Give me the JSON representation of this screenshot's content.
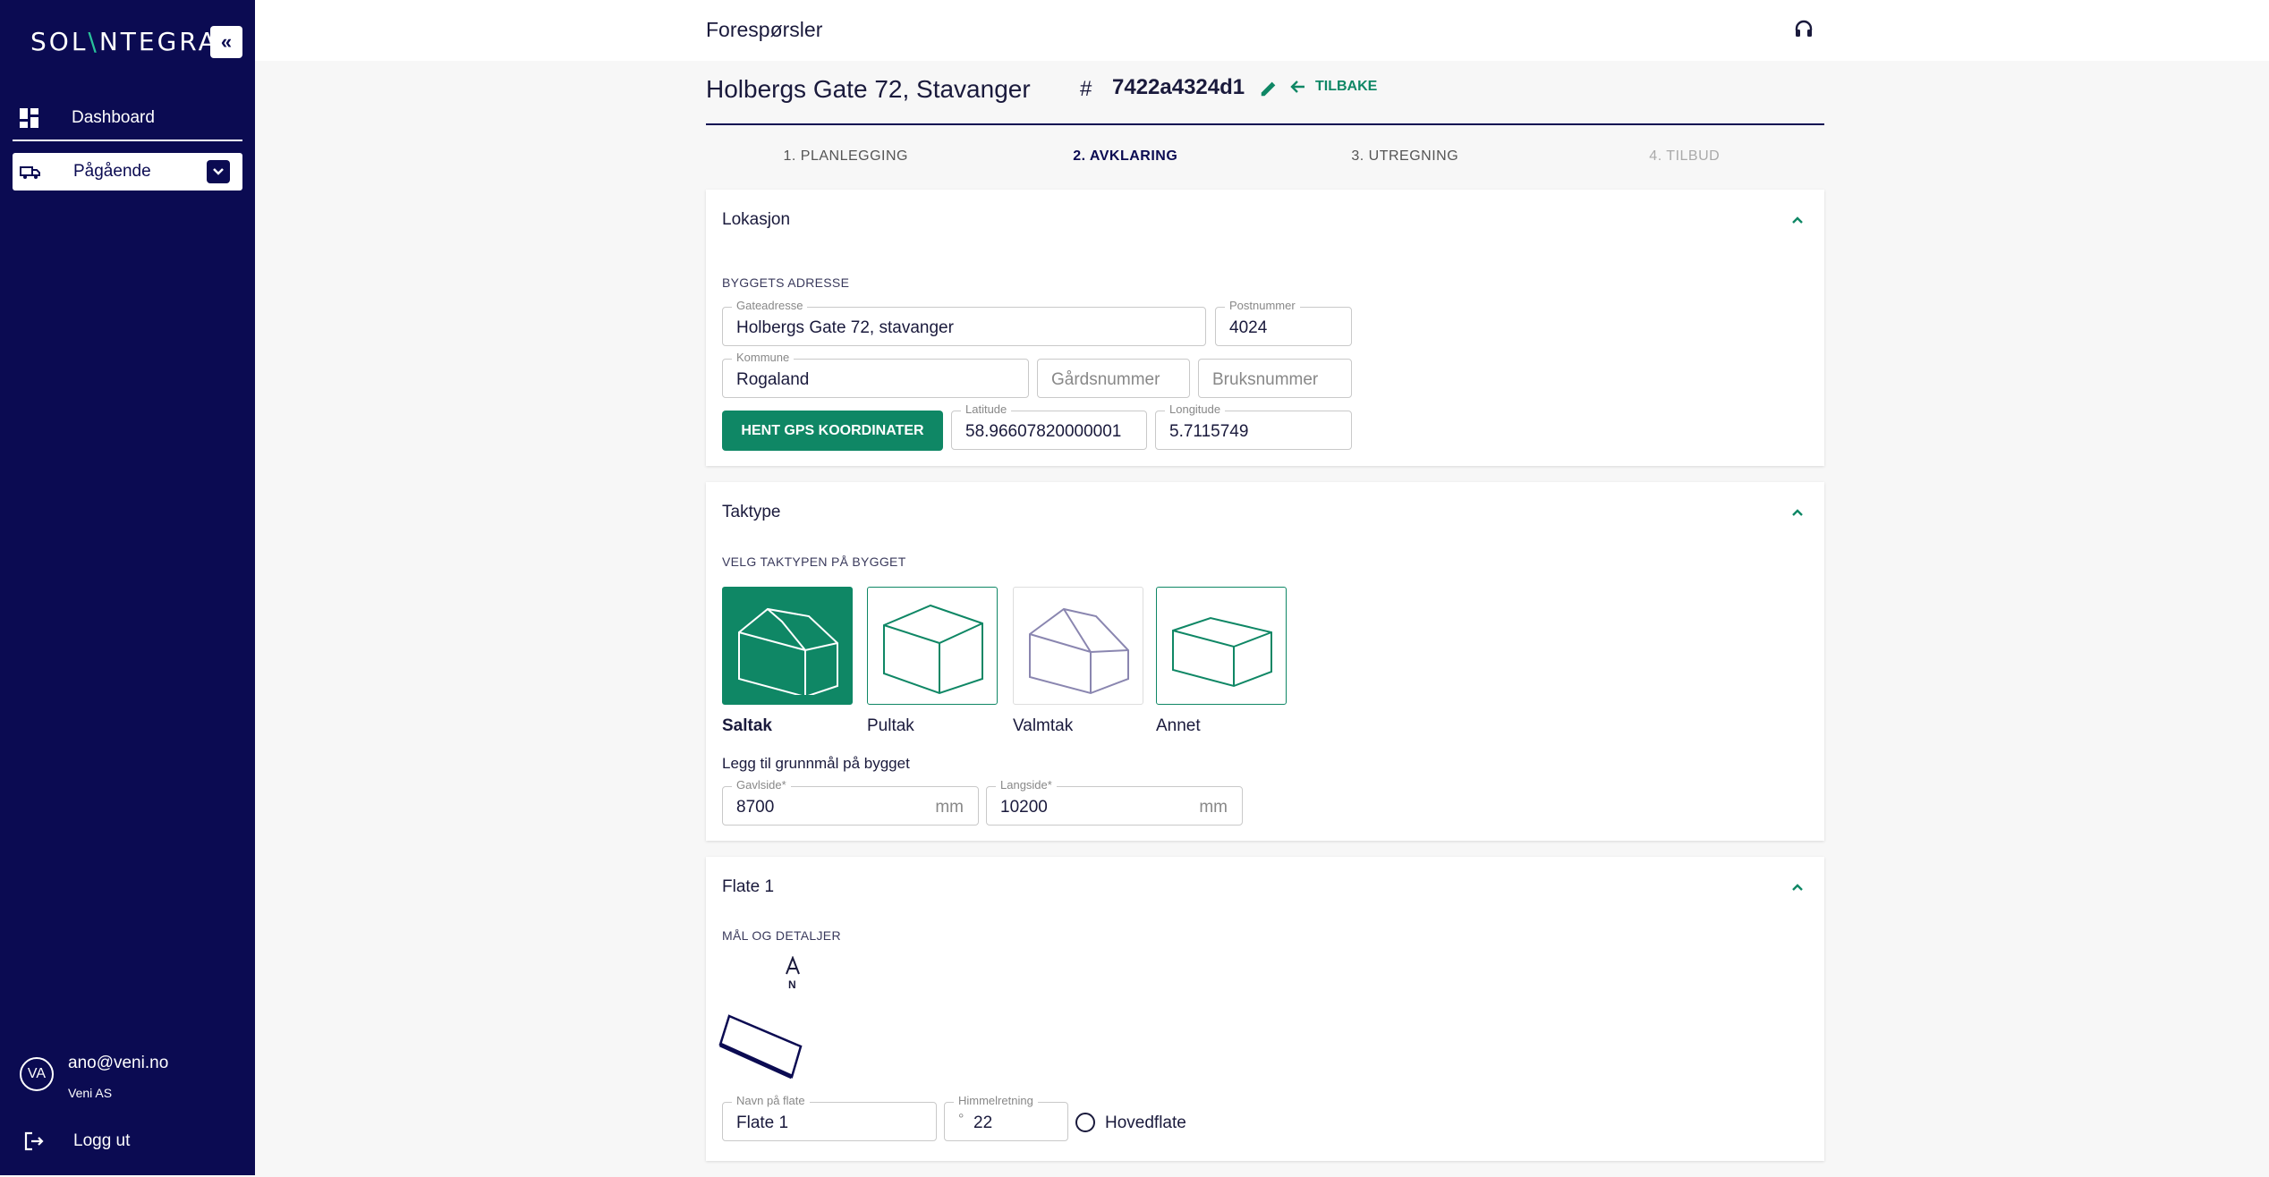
{
  "sidebar": {
    "logo": {
      "part1": "SOL",
      "slash": "\\",
      "part2": "NTEGRA"
    },
    "collapse_label": "«",
    "items": [
      {
        "label": "Dashboard",
        "icon": "dashboard-icon"
      },
      {
        "label": "Pågående",
        "icon": "truck-icon"
      }
    ],
    "user": {
      "initials": "VA",
      "email": "ano@veni.no",
      "org": "Veni AS"
    },
    "logout_label": "Logg ut"
  },
  "topbar": {
    "title": "Forespørsler",
    "support_icon": "headset-icon"
  },
  "project": {
    "title": "Holbergs Gate 72, Stavanger",
    "hash": "#",
    "id": "7422a4324d1",
    "back_label": "TILBAKE"
  },
  "tabs": [
    {
      "label": "1. PLANLEGGING",
      "state": "done"
    },
    {
      "label": "2. AVKLARING",
      "state": "active"
    },
    {
      "label": "3. UTREGNING",
      "state": "todo"
    },
    {
      "label": "4. TILBUD",
      "state": "disabled"
    }
  ],
  "lokasjon": {
    "title": "Lokasjon",
    "section_label": "BYGGETS ADRESSE",
    "gateadresse": {
      "label": "Gateadresse",
      "value": "Holbergs Gate 72, stavanger"
    },
    "postnummer": {
      "label": "Postnummer",
      "value": "4024"
    },
    "kommune": {
      "label": "Kommune",
      "value": "Rogaland"
    },
    "gardsnummer": {
      "placeholder": "Gårdsnummer"
    },
    "bruksnummer": {
      "placeholder": "Bruksnummer"
    },
    "gps_button": "HENT GPS KOORDINATER",
    "latitude": {
      "label": "Latitude",
      "value": "58.96607820000001"
    },
    "longitude": {
      "label": "Longitude",
      "value": "5.7115749"
    }
  },
  "taktype": {
    "title": "Taktype",
    "section_label": "VELG TAKTYPEN PÅ BYGGET",
    "options": [
      {
        "label": "Saltak",
        "selected": true
      },
      {
        "label": "Pultak",
        "selected": false
      },
      {
        "label": "Valmtak",
        "selected": false
      },
      {
        "label": "Annet",
        "selected": false
      }
    ],
    "grunnmal_label": "Legg til grunnmål på bygget",
    "gavlside": {
      "label": "Gavlside*",
      "value": "8700",
      "unit": "mm"
    },
    "langside": {
      "label": "Langside*",
      "value": "10200",
      "unit": "mm"
    }
  },
  "flate": {
    "title": "Flate 1",
    "section_label": "MÅL OG DETALJER",
    "north_label": "N",
    "navn": {
      "label": "Navn på flate",
      "value": "Flate 1"
    },
    "himmelretning": {
      "label": "Himmelretning",
      "prefix": "°",
      "value": "22"
    },
    "hovedflate_label": "Hovedflate"
  },
  "colors": {
    "sidebar": "#0b0b52",
    "accent": "#0f8765",
    "logo_slash": "#29c29a"
  }
}
